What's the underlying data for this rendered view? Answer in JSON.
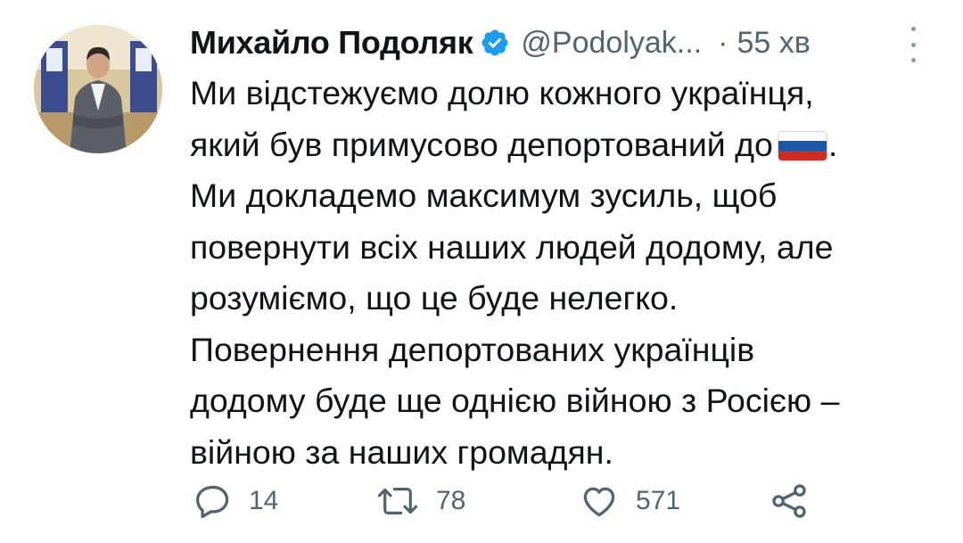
{
  "tweet": {
    "author_name": "Михайло Подоляк",
    "handle": "@Podolyak...",
    "separator": "·",
    "time": "55 хв",
    "text_lines": [
      "Ми відстежуємо долю кожного українця,",
      "який був примусово депортований до",
      "Ми докладемо максимум зусиль, щоб",
      "повернути всіх наших людей додому, але",
      "розуміємо, що це буде нелегко.",
      "Повернення депортованих українців",
      "додому буде ще однією війною з Росією –",
      "війною за наших громадян."
    ],
    "line2_suffix": ".",
    "flag_emoji": "russia-flag",
    "colors": {
      "verified": "#1d9bf0",
      "text": "#0f1419",
      "muted": "#536471"
    }
  },
  "actions": {
    "replies": "14",
    "retweets": "78",
    "likes": "571"
  }
}
